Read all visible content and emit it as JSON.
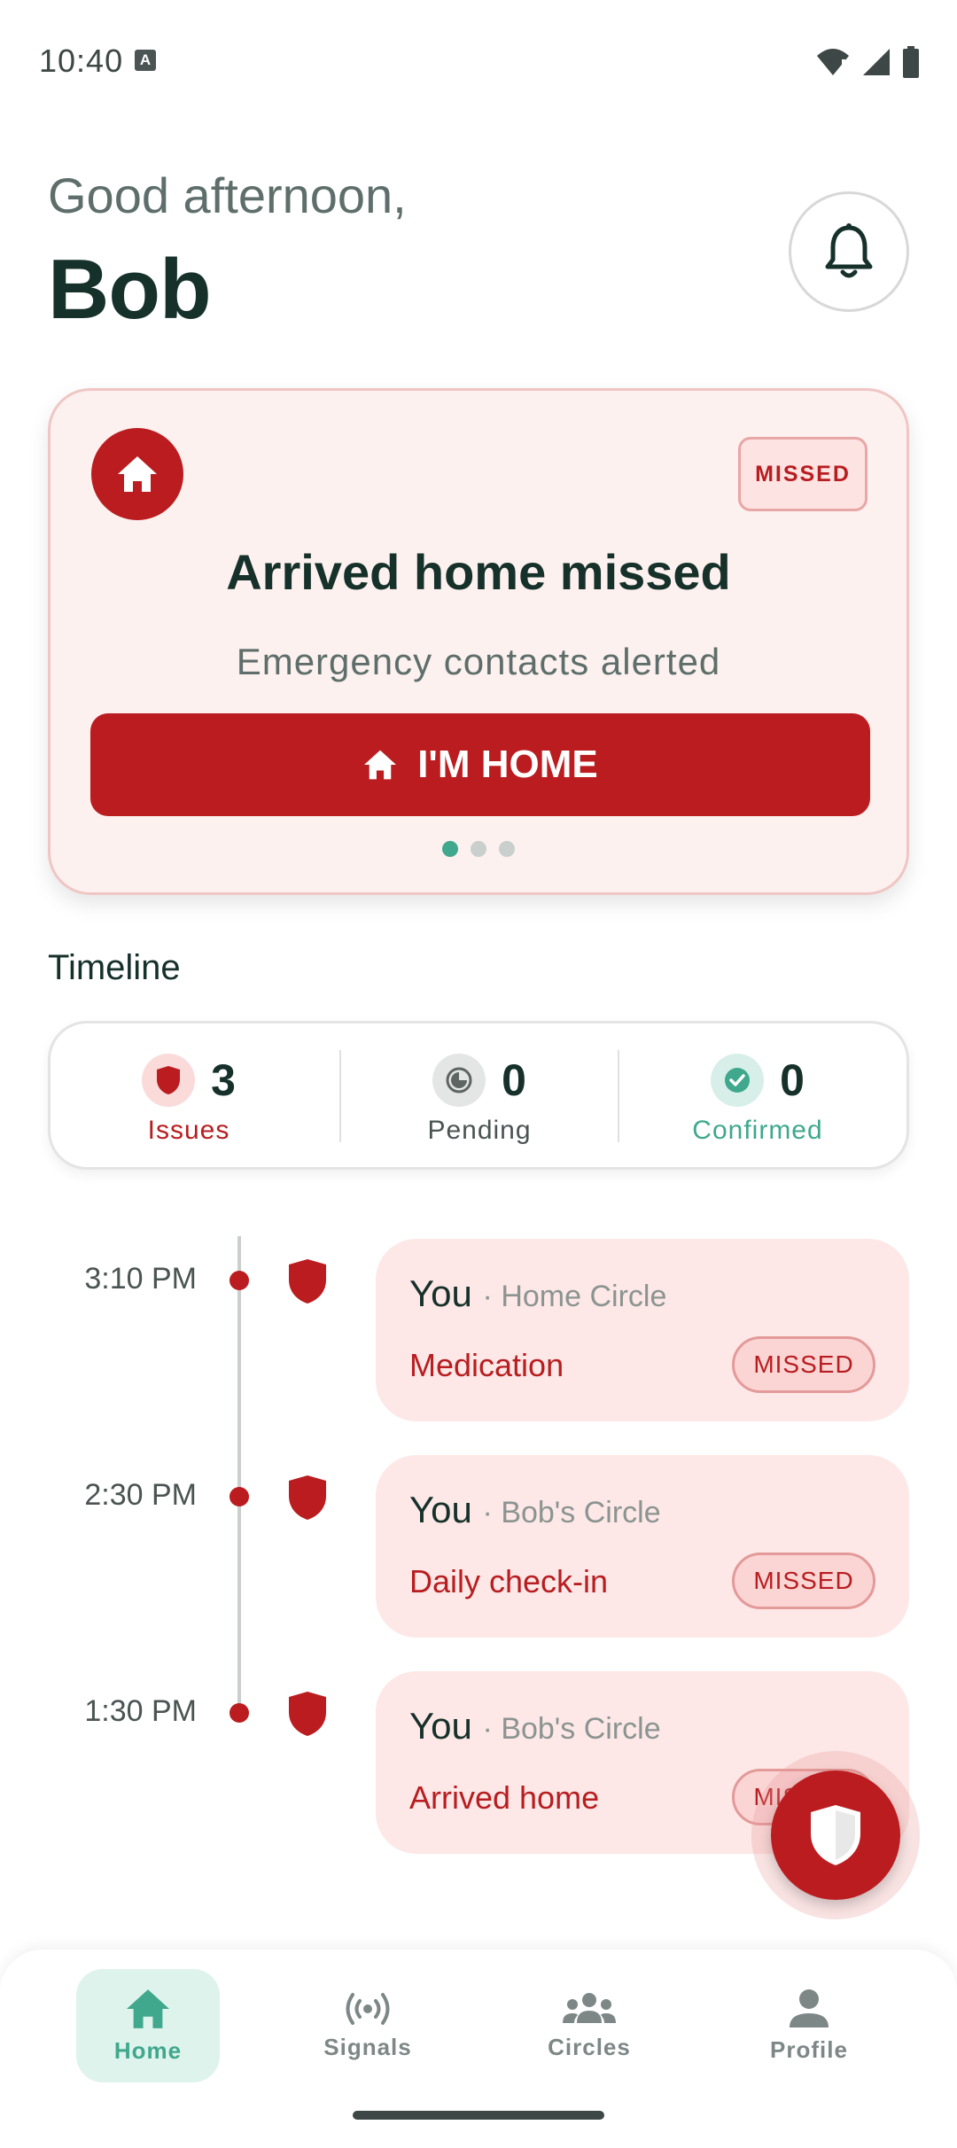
{
  "status_bar": {
    "time": "10:40",
    "notification_icon_letter": "A"
  },
  "header": {
    "greeting": "Good afternoon,",
    "name": "Bob"
  },
  "alert_card": {
    "badge": "MISSED",
    "title": "Arrived home missed",
    "subtitle": "Emergency contacts alerted",
    "action_label": "I'M HOME",
    "page_count": 3,
    "active_page": 1
  },
  "timeline": {
    "heading": "Timeline",
    "summary": [
      {
        "count": "3",
        "label": "Issues"
      },
      {
        "count": "0",
        "label": "Pending"
      },
      {
        "count": "0",
        "label": "Confirmed"
      }
    ],
    "entries": [
      {
        "time": "3:10 PM",
        "who": "You",
        "circle": "· Home Circle",
        "event": "Medication",
        "status": "MISSED"
      },
      {
        "time": "2:30 PM",
        "who": "You",
        "circle": "· Bob's Circle",
        "event": "Daily check-in",
        "status": "MISSED"
      },
      {
        "time": "1:30 PM",
        "who": "You",
        "circle": "· Bob's Circle",
        "event": "Arrived home",
        "status": "MISSED"
      }
    ]
  },
  "bottom_nav": {
    "items": [
      {
        "label": "Home",
        "icon": "home-icon",
        "active": true
      },
      {
        "label": "Signals",
        "icon": "signals-icon",
        "active": false
      },
      {
        "label": "Circles",
        "icon": "circles-icon",
        "active": false
      },
      {
        "label": "Profile",
        "icon": "profile-icon",
        "active": false
      }
    ]
  },
  "colors": {
    "brand_red": "#bb1c1f",
    "accent_green": "#3fa88d",
    "card_pink": "#fdf1f0",
    "text_dark": "#16302a"
  }
}
